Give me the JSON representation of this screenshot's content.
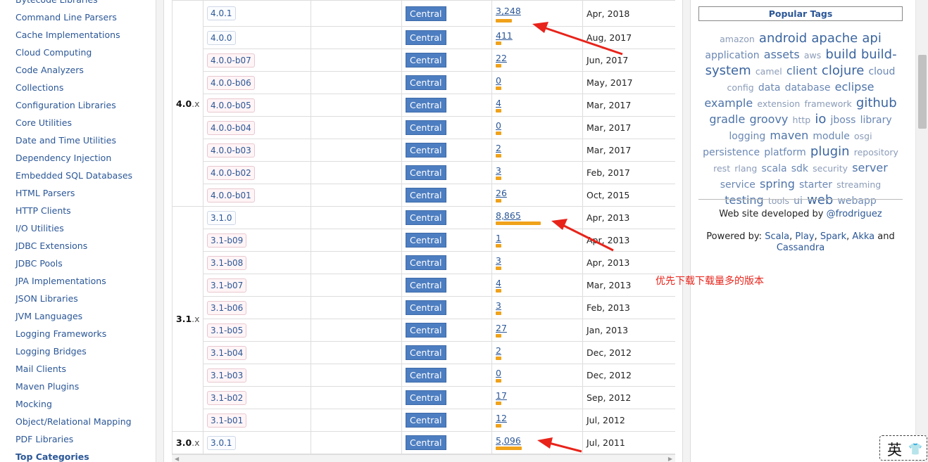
{
  "sidebar": {
    "items": [
      "Bytecode Libraries",
      "Command Line Parsers",
      "Cache Implementations",
      "Cloud Computing",
      "Code Analyzers",
      "Collections",
      "Configuration Libraries",
      "Core Utilities",
      "Date and Time Utilities",
      "Dependency Injection",
      "Embedded SQL Databases",
      "HTML Parsers",
      "HTTP Clients",
      "I/O Utilities",
      "JDBC Extensions",
      "JDBC Pools",
      "JPA Implementations",
      "JSON Libraries",
      "JVM Languages",
      "Logging Frameworks",
      "Logging Bridges",
      "Mail Clients",
      "Maven Plugins",
      "Mocking",
      "Object/Relational Mapping",
      "PDF Libraries"
    ],
    "bottom_item": "Top Categories"
  },
  "versions": {
    "repo_label": "Central",
    "groups": [
      {
        "major": "4.0",
        "suffix": ".x",
        "rows": [
          {
            "version": "4.0.1",
            "beta": false,
            "usages": "3,248",
            "usage_num": 3248,
            "date": "Apr, 2018"
          },
          {
            "version": "4.0.0",
            "beta": false,
            "usages": "411",
            "usage_num": 411,
            "date": "Aug, 2017"
          },
          {
            "version": "4.0.0-b07",
            "beta": true,
            "usages": "22",
            "usage_num": 22,
            "date": "Jun, 2017"
          },
          {
            "version": "4.0.0-b06",
            "beta": true,
            "usages": "0",
            "usage_num": 0,
            "date": "May, 2017"
          },
          {
            "version": "4.0.0-b05",
            "beta": true,
            "usages": "4",
            "usage_num": 4,
            "date": "Mar, 2017"
          },
          {
            "version": "4.0.0-b04",
            "beta": true,
            "usages": "0",
            "usage_num": 0,
            "date": "Mar, 2017"
          },
          {
            "version": "4.0.0-b03",
            "beta": true,
            "usages": "2",
            "usage_num": 2,
            "date": "Mar, 2017"
          },
          {
            "version": "4.0.0-b02",
            "beta": true,
            "usages": "3",
            "usage_num": 3,
            "date": "Feb, 2017"
          },
          {
            "version": "4.0.0-b01",
            "beta": true,
            "usages": "26",
            "usage_num": 26,
            "date": "Oct, 2015"
          }
        ]
      },
      {
        "major": "3.1",
        "suffix": ".x",
        "rows": [
          {
            "version": "3.1.0",
            "beta": false,
            "usages": "8,865",
            "usage_num": 8865,
            "date": "Apr, 2013"
          },
          {
            "version": "3.1-b09",
            "beta": true,
            "usages": "1",
            "usage_num": 1,
            "date": "Apr, 2013"
          },
          {
            "version": "3.1-b08",
            "beta": true,
            "usages": "3",
            "usage_num": 3,
            "date": "Apr, 2013"
          },
          {
            "version": "3.1-b07",
            "beta": true,
            "usages": "4",
            "usage_num": 4,
            "date": "Mar, 2013"
          },
          {
            "version": "3.1-b06",
            "beta": true,
            "usages": "3",
            "usage_num": 3,
            "date": "Feb, 2013"
          },
          {
            "version": "3.1-b05",
            "beta": true,
            "usages": "27",
            "usage_num": 27,
            "date": "Jan, 2013"
          },
          {
            "version": "3.1-b04",
            "beta": true,
            "usages": "2",
            "usage_num": 2,
            "date": "Dec, 2012"
          },
          {
            "version": "3.1-b03",
            "beta": true,
            "usages": "0",
            "usage_num": 0,
            "date": "Dec, 2012"
          },
          {
            "version": "3.1-b02",
            "beta": true,
            "usages": "17",
            "usage_num": 17,
            "date": "Sep, 2012"
          },
          {
            "version": "3.1-b01",
            "beta": true,
            "usages": "12",
            "usage_num": 12,
            "date": "Jul, 2012"
          }
        ]
      },
      {
        "major": "3.0",
        "suffix": ".x",
        "rows": [
          {
            "version": "3.0.1",
            "beta": false,
            "usages": "5,096",
            "usage_num": 5096,
            "date": "Jul, 2011"
          }
        ]
      }
    ]
  },
  "annotation": {
    "text": "优先下载下载量多的版本",
    "color": "#e8231a"
  },
  "popular_tags": {
    "title": "Popular Tags",
    "tags": [
      {
        "t": "amazon",
        "s": 1
      },
      {
        "t": "android",
        "s": 4
      },
      {
        "t": "apache",
        "s": 4
      },
      {
        "t": "api",
        "s": 4
      },
      {
        "t": "application",
        "s": 2
      },
      {
        "t": "assets",
        "s": 3
      },
      {
        "t": "aws",
        "s": 1
      },
      {
        "t": "build",
        "s": 4
      },
      {
        "t": "build-system",
        "s": 4
      },
      {
        "t": "camel",
        "s": 1
      },
      {
        "t": "client",
        "s": 3
      },
      {
        "t": "clojure",
        "s": 4
      },
      {
        "t": "cloud",
        "s": 2
      },
      {
        "t": "config",
        "s": 1
      },
      {
        "t": "data",
        "s": 2
      },
      {
        "t": "database",
        "s": 2
      },
      {
        "t": "eclipse",
        "s": 3
      },
      {
        "t": "example",
        "s": 3
      },
      {
        "t": "extension",
        "s": 1
      },
      {
        "t": "framework",
        "s": 1
      },
      {
        "t": "github",
        "s": 4
      },
      {
        "t": "gradle",
        "s": 3
      },
      {
        "t": "groovy",
        "s": 3
      },
      {
        "t": "http",
        "s": 1
      },
      {
        "t": "io",
        "s": 4
      },
      {
        "t": "jboss",
        "s": 2
      },
      {
        "t": "library",
        "s": 2
      },
      {
        "t": "logging",
        "s": 2
      },
      {
        "t": "maven",
        "s": 3
      },
      {
        "t": "module",
        "s": 2
      },
      {
        "t": "osgi",
        "s": 1
      },
      {
        "t": "persistence",
        "s": 2
      },
      {
        "t": "platform",
        "s": 2
      },
      {
        "t": "plugin",
        "s": 4
      },
      {
        "t": "repository",
        "s": 1
      },
      {
        "t": "rest",
        "s": 1
      },
      {
        "t": "rlang",
        "s": 1
      },
      {
        "t": "scala",
        "s": 2
      },
      {
        "t": "sdk",
        "s": 2
      },
      {
        "t": "security",
        "s": 1
      },
      {
        "t": "server",
        "s": 3
      },
      {
        "t": "service",
        "s": 2
      },
      {
        "t": "spring",
        "s": 3
      },
      {
        "t": "starter",
        "s": 2
      },
      {
        "t": "streaming",
        "s": 1
      },
      {
        "t": "testing",
        "s": 3
      },
      {
        "t": "tools",
        "s": 1
      },
      {
        "t": "ui",
        "s": 2
      },
      {
        "t": "web",
        "s": 4
      },
      {
        "t": "webapp",
        "s": 2
      }
    ]
  },
  "credits": {
    "developed_by_prefix": "Web site developed by",
    "developer": "@frodriguez",
    "powered_prefix": "Powered by:",
    "tech1": "Scala",
    "tech2": "Play",
    "tech3": "Spark",
    "tech4": "Akka",
    "and_word": "and",
    "tech5": "Cassandra"
  },
  "ime": {
    "mode_char": "英",
    "skin_icon": "shirt-icon"
  }
}
